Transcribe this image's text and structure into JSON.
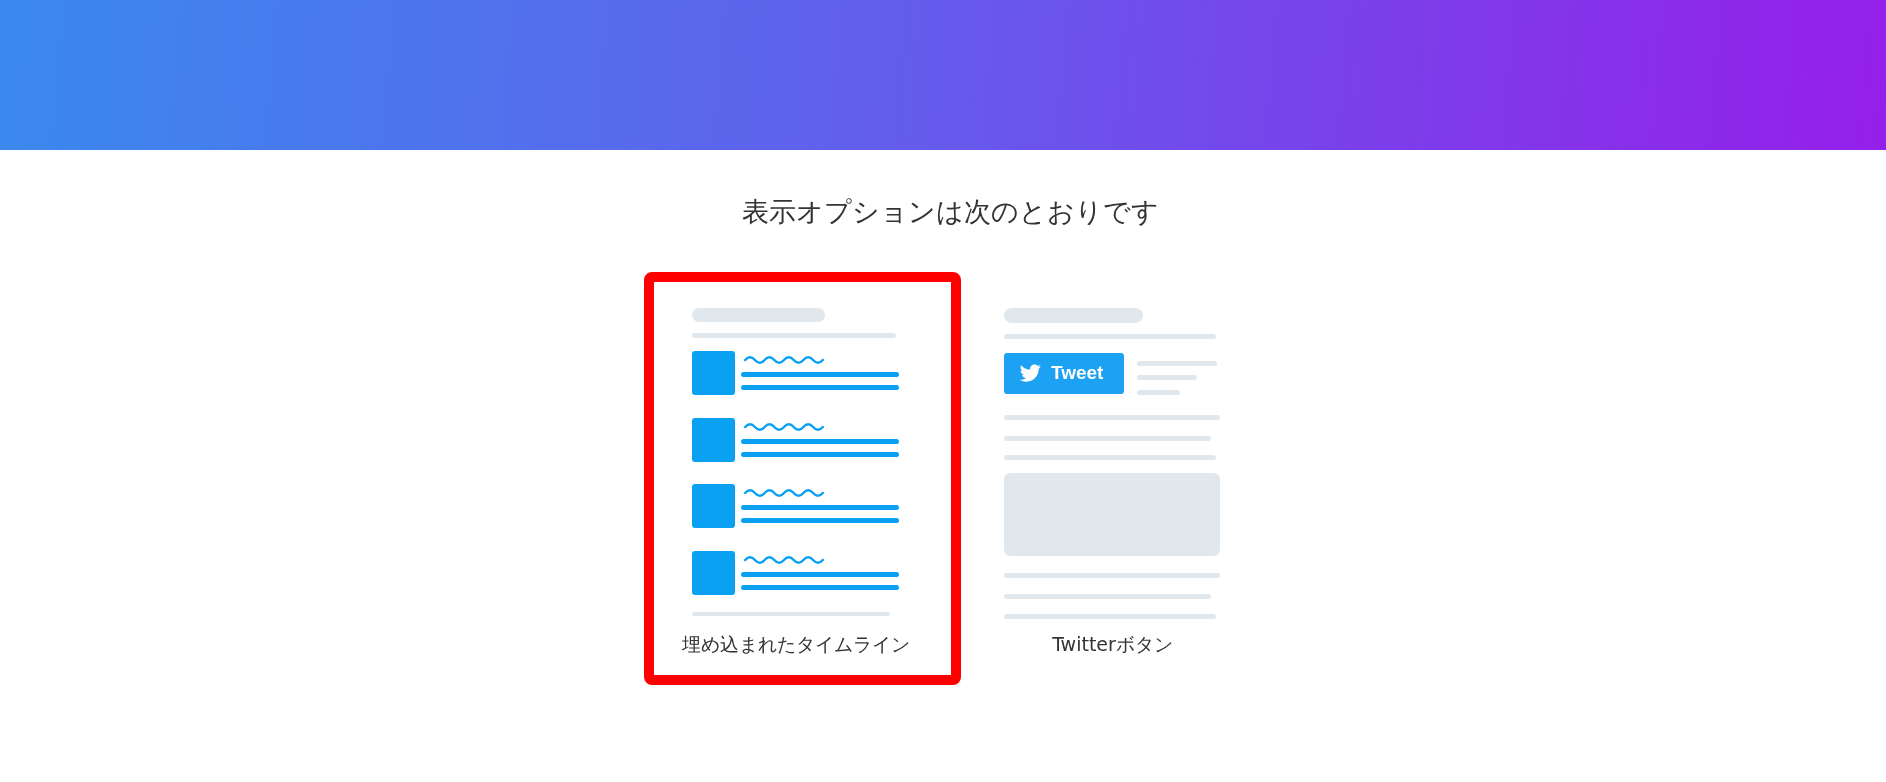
{
  "heading": "表示オプションは次のとおりです",
  "options": [
    {
      "kind": "timeline",
      "label": "埋め込まれたタイムライン",
      "selected": true
    },
    {
      "kind": "button",
      "label": "Twitterボタン",
      "selected": false,
      "button_label": "Tweet"
    }
  ]
}
